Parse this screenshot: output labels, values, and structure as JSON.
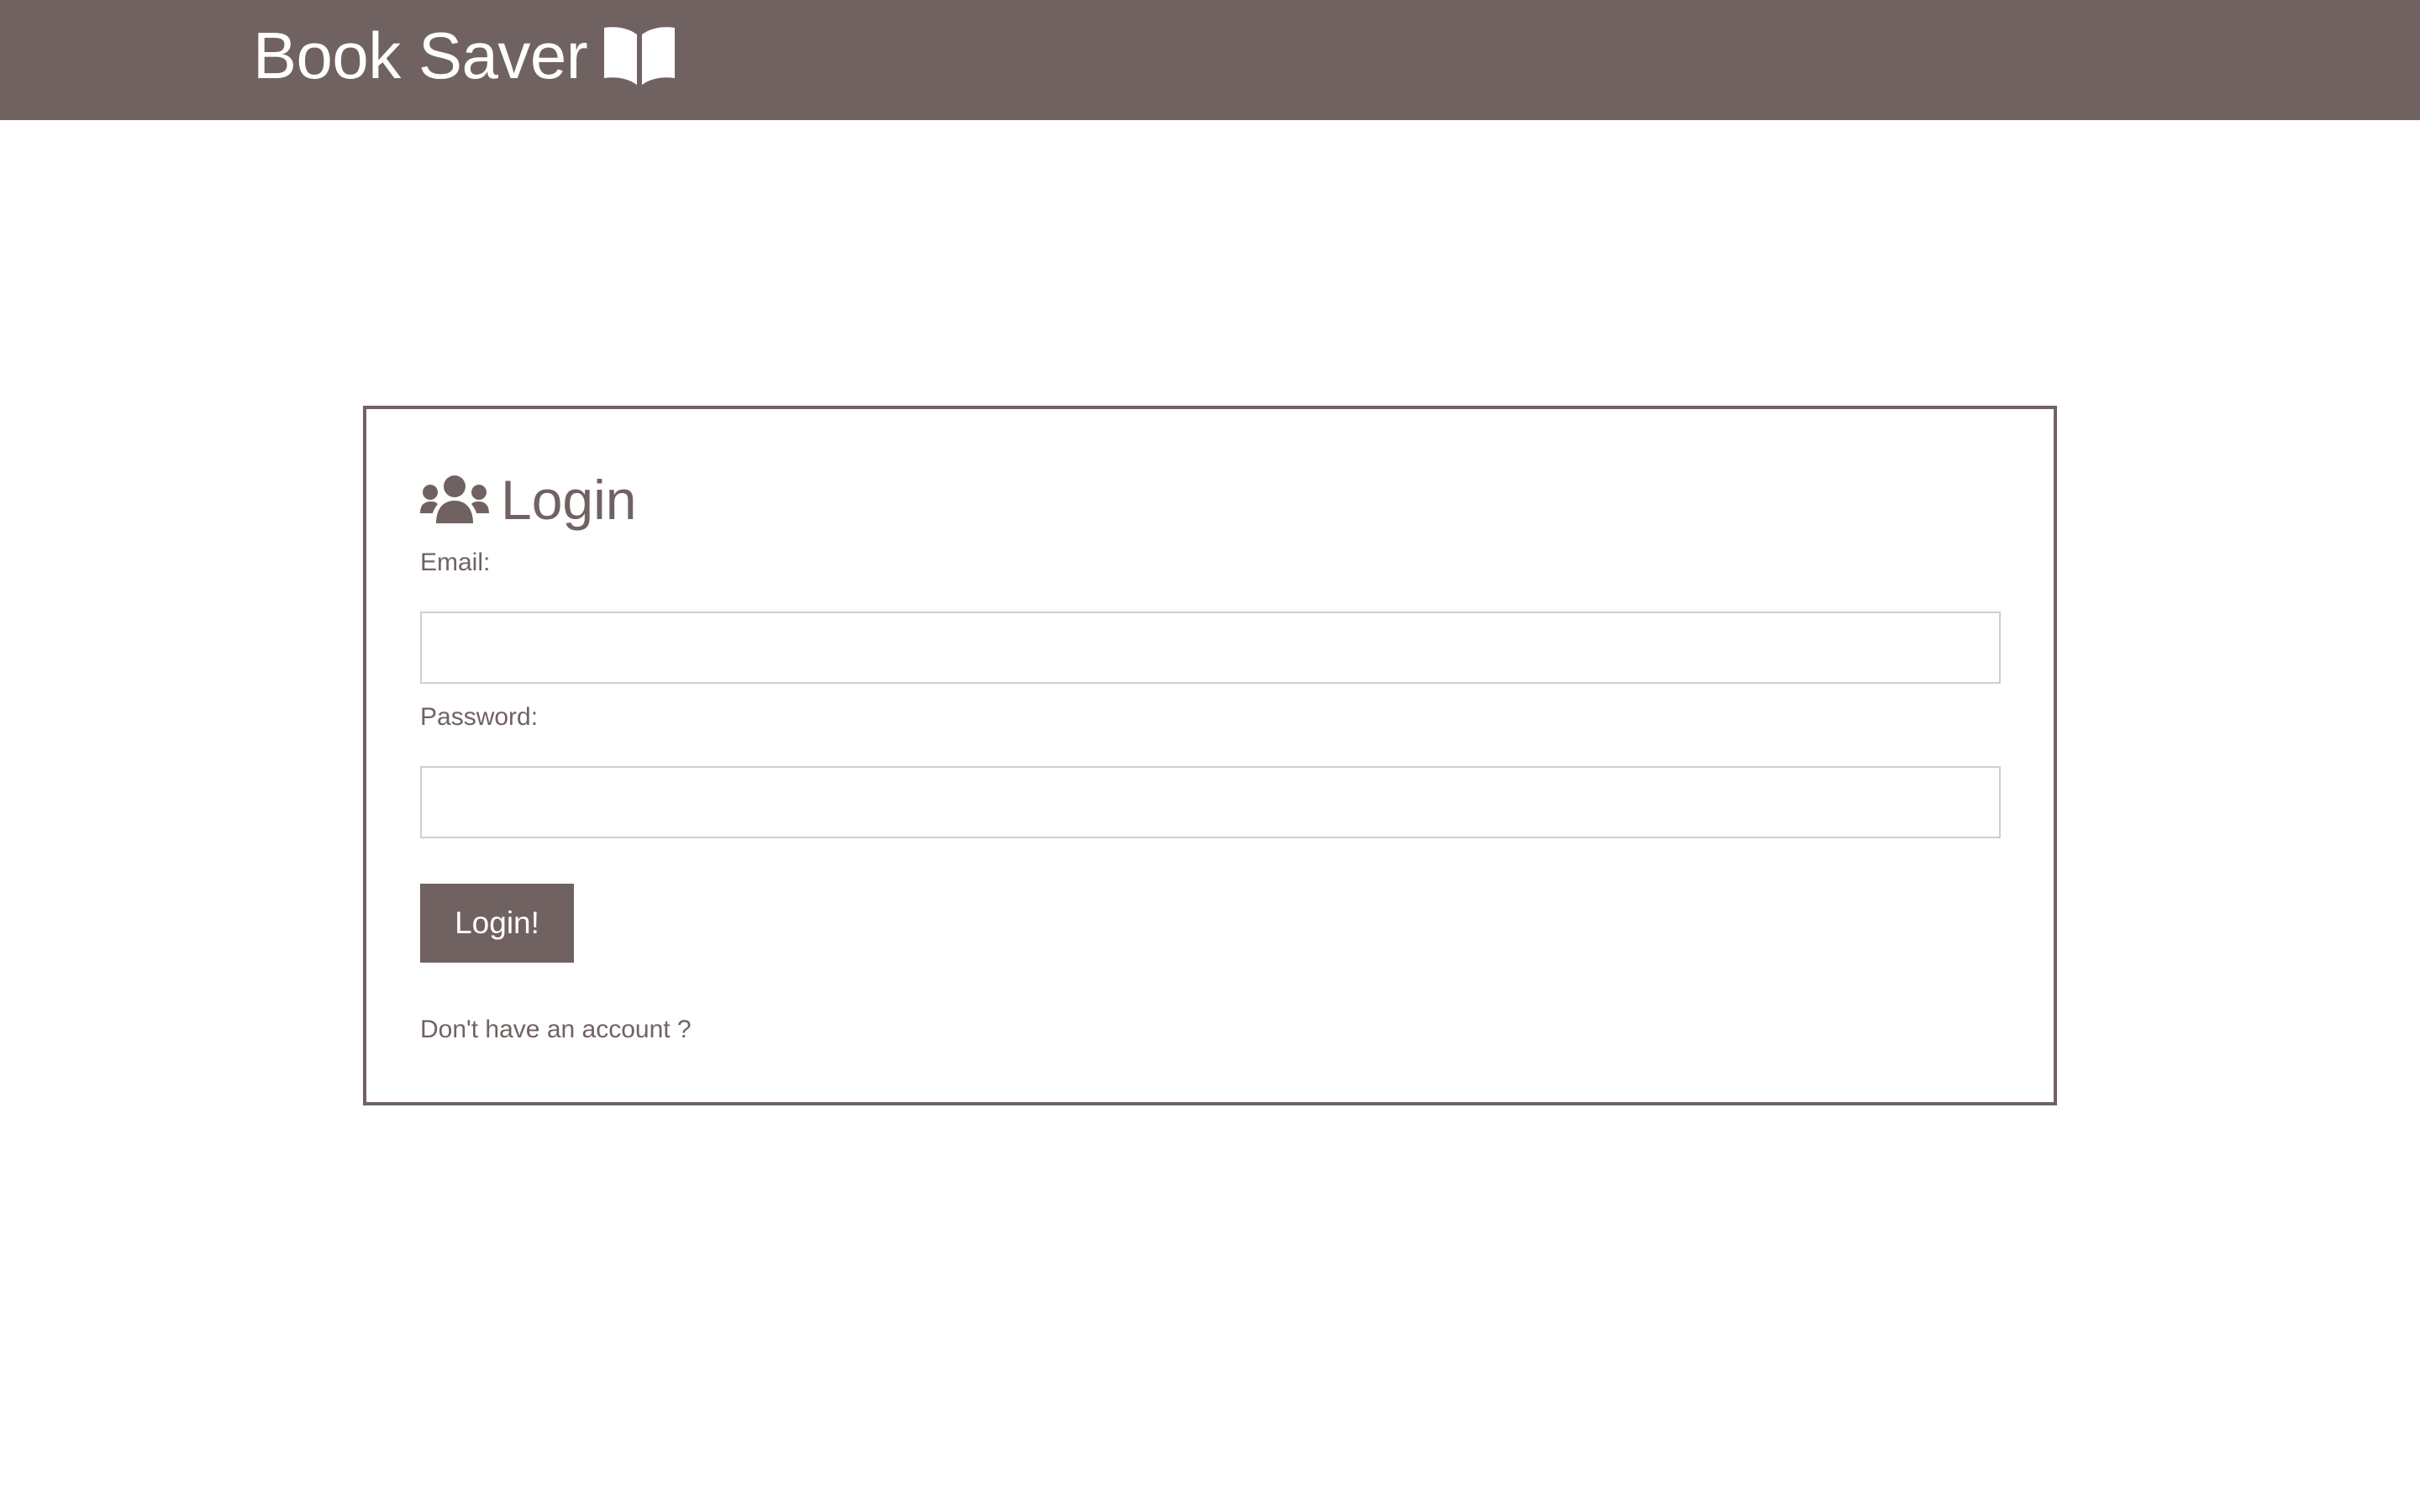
{
  "header": {
    "brand_text": "Book Saver",
    "brand_icon": "open-book-icon",
    "background_color": "#716262",
    "text_color": "#ffffff"
  },
  "login_card": {
    "heading_icon": "users-icon",
    "heading": "Login",
    "email_label": "Email:",
    "email_value": "",
    "password_label": "Password:",
    "password_value": "",
    "submit_label": "Login!",
    "signup_prompt": "Don't have an account ?",
    "accent_color": "#716262"
  }
}
